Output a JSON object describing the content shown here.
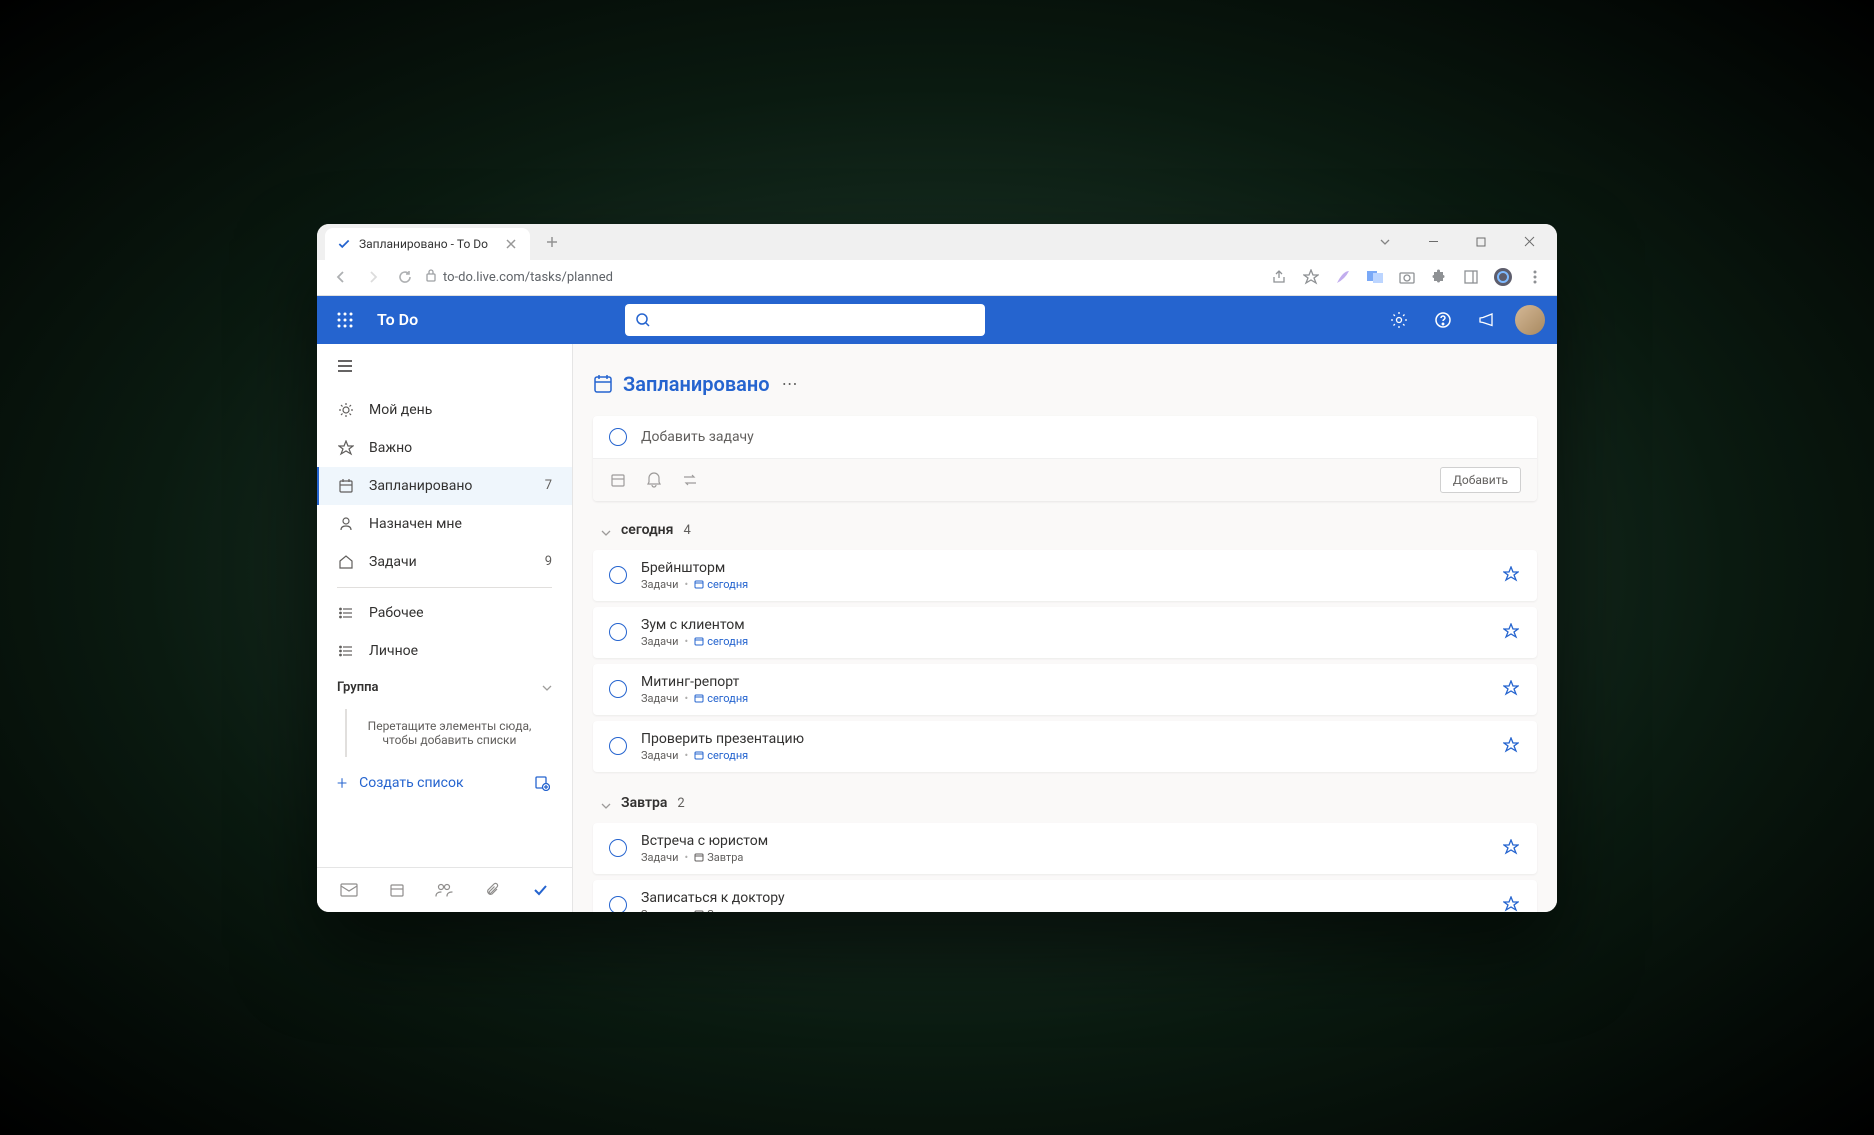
{
  "browser": {
    "tab_title": "Запланировано - To Do",
    "url": "to-do.live.com/tasks/planned"
  },
  "app": {
    "title": "To Do"
  },
  "sidebar": {
    "items": [
      {
        "label": "Мой день",
        "count": ""
      },
      {
        "label": "Важно",
        "count": ""
      },
      {
        "label": "Запланировано",
        "count": "7"
      },
      {
        "label": "Назначен мне",
        "count": ""
      },
      {
        "label": "Задачи",
        "count": "9"
      }
    ],
    "custom_lists": [
      {
        "label": "Рабочее"
      },
      {
        "label": "Личное"
      }
    ],
    "group_label": "Группа",
    "group_drop_hint": "Перетащите элементы сюда, чтобы добавить списки",
    "create_list_label": "Создать список"
  },
  "main": {
    "heading": "Запланировано",
    "add_task_placeholder": "Добавить задачу",
    "add_button": "Добавить",
    "sections": [
      {
        "title": "сегодня",
        "count": "4",
        "tasks": [
          {
            "title": "Брейншторм",
            "list": "Задачи",
            "due": "сегодня",
            "due_color": "blue"
          },
          {
            "title": "Зум с клиентом",
            "list": "Задачи",
            "due": "сегодня",
            "due_color": "blue"
          },
          {
            "title": "Митинг-репорт",
            "list": "Задачи",
            "due": "сегодня",
            "due_color": "blue"
          },
          {
            "title": "Проверить презентацию",
            "list": "Задачи",
            "due": "сегодня",
            "due_color": "blue"
          }
        ]
      },
      {
        "title": "Завтра",
        "count": "2",
        "tasks": [
          {
            "title": "Встреча с юристом",
            "list": "Задачи",
            "due": "Завтра",
            "due_color": "gray"
          },
          {
            "title": "Записаться к доктору",
            "list": "Задачи",
            "due": "Завтра",
            "due_color": "gray"
          }
        ]
      }
    ]
  }
}
